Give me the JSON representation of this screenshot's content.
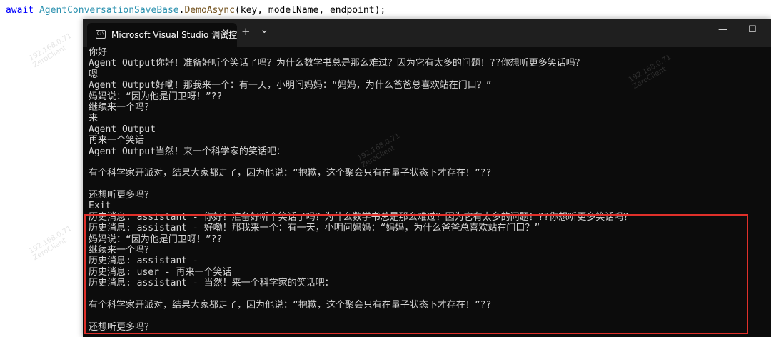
{
  "editor": {
    "code": {
      "kw_await": "await",
      "class_name": "AgentConversationSaveBase",
      "dot": ".",
      "method": "DemoAsync",
      "args": "(key, modelName, endpoint);"
    }
  },
  "window": {
    "tab_title": "Microsoft Visual Studio 调试控",
    "tab_icon": "console-icon",
    "close_tab": "✕",
    "new_tab": "+",
    "dropdown": "⌄",
    "minimize": "—",
    "maximize": "☐"
  },
  "console_lines": [
    "你好",
    "Agent Output你好！准备好听个笑话了吗？为什么数学书总是那么难过？因为它有太多的问题！??你想听更多笑话吗？",
    "嗯",
    "Agent Output好嘞！那我来一个：有一天，小明问妈妈：“妈妈，为什么爸爸总喜欢站在门口？”",
    "妈妈说：“因为他是门卫呀！”??",
    "继续来一个吗？",
    "来",
    "Agent Output",
    "再来一个笑话",
    "Agent Output当然！来一个科学家的笑话吧：",
    "",
    "有个科学家开派对，结果大家都走了，因为他说：“抱歉，这个聚会只有在量子状态下才存在！”??",
    "",
    "还想听更多吗？",
    "Exit",
    "历史消息: assistant - 你好！准备好听个笑话了吗？为什么数学书总是那么难过？因为它有太多的问题！??你想听更多笑话吗？",
    "历史消息: assistant - 好嘞！那我来一个：有一天，小明问妈妈：“妈妈，为什么爸爸总喜欢站在门口？”",
    "妈妈说：“因为他是门卫呀！”??",
    "继续来一个吗？",
    "历史消息: assistant -",
    "历史消息: user - 再来一个笑话",
    "历史消息: assistant - 当然！来一个科学家的笑话吧：",
    "",
    "有个科学家开派对，结果大家都走了，因为他说：“抱歉，这个聚会只有在量子状态下才存在！”??",
    "",
    "还想听更多吗？"
  ],
  "colors": {
    "highlight_border": "#e0302a",
    "console_bg": "#0c0c0c",
    "console_text": "#d4d4d4"
  }
}
